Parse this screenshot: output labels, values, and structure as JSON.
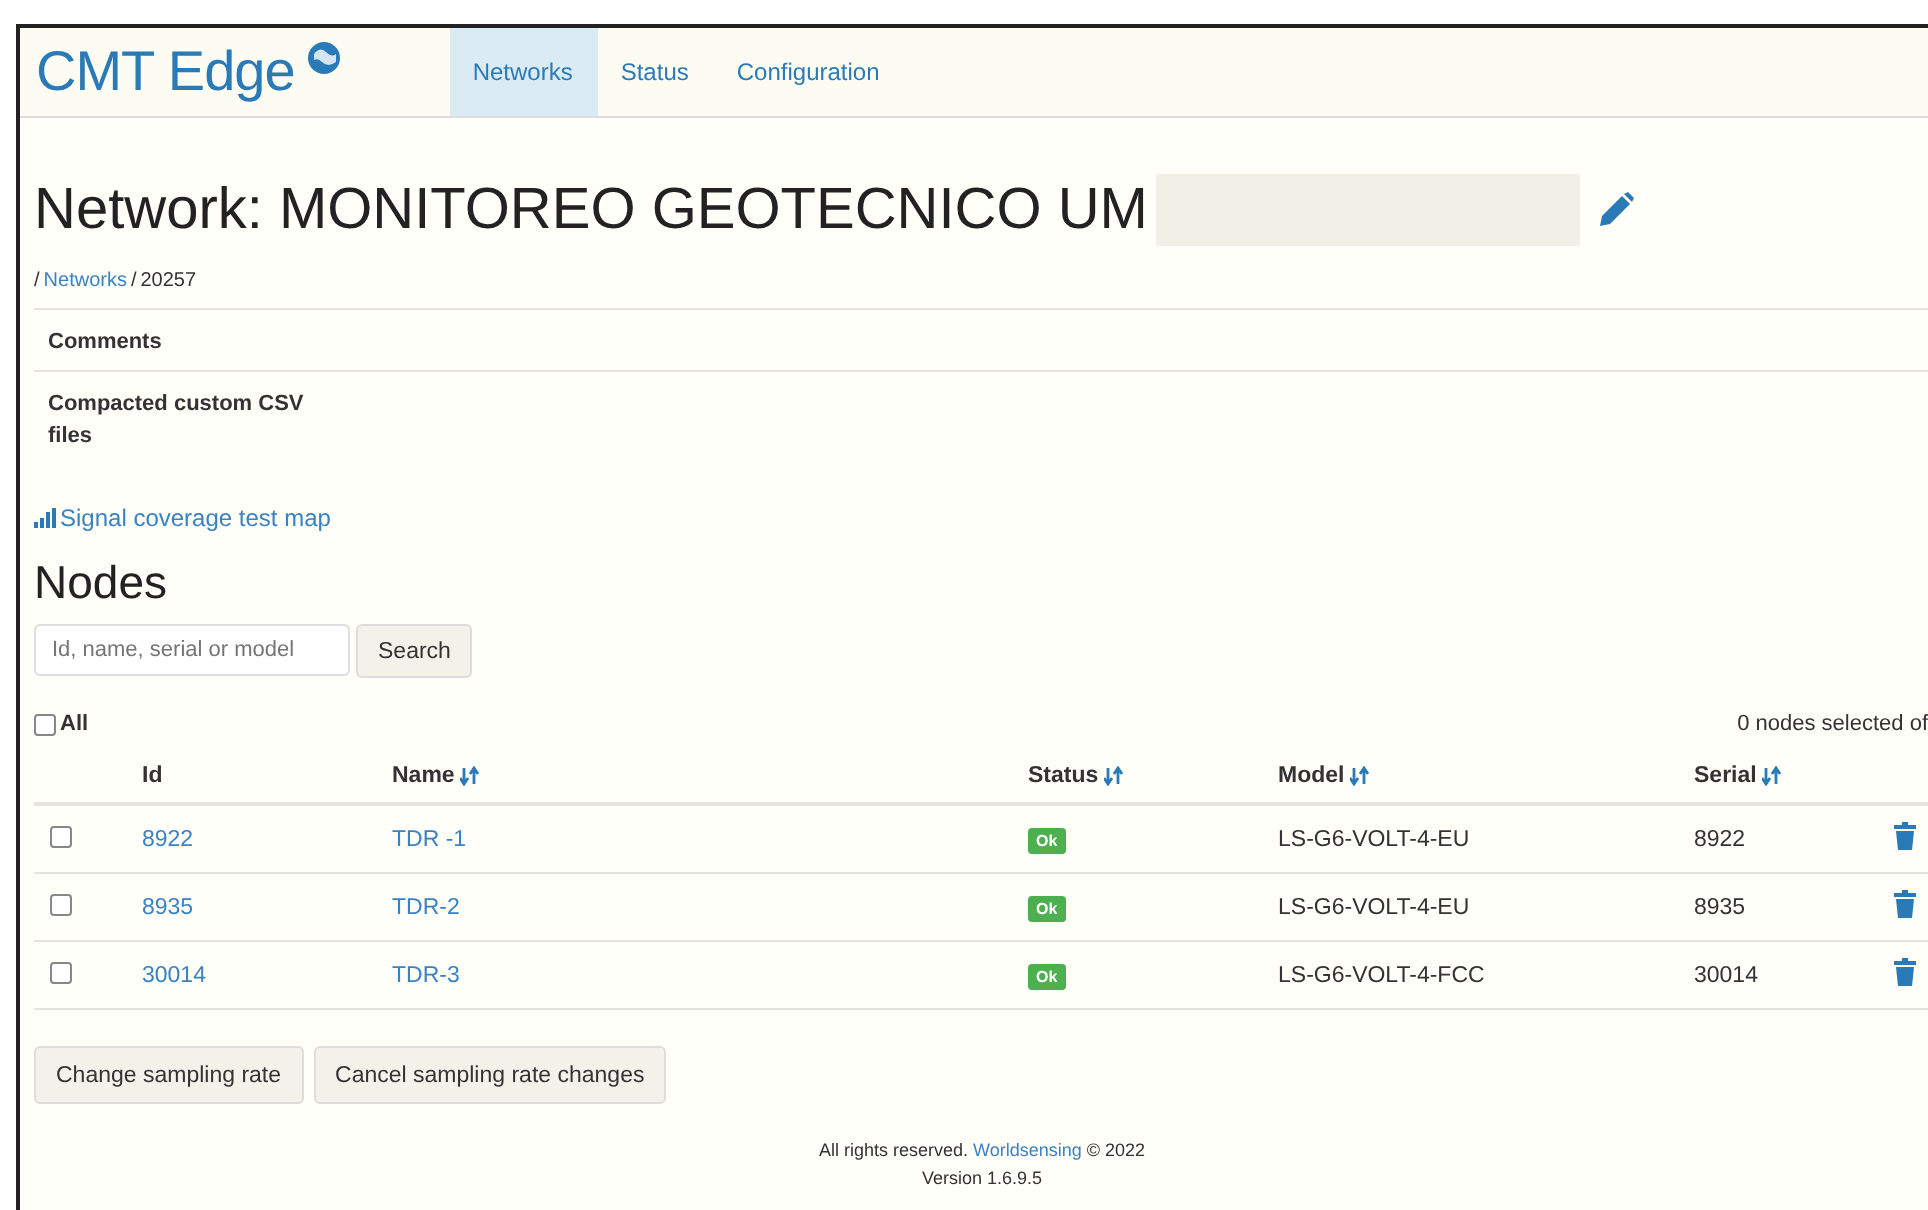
{
  "header": {
    "logo": "CMT Edge",
    "nav": [
      {
        "label": "Networks",
        "selected": true
      },
      {
        "label": "Status",
        "selected": false
      },
      {
        "label": "Configuration",
        "selected": false
      }
    ]
  },
  "title": "Network: MONITOREO GEOTECNICO UM",
  "breadcrumb": {
    "separator": "/",
    "link": "Networks",
    "current": "20257"
  },
  "details": [
    {
      "label": "Comments"
    },
    {
      "label": "Compacted custom CSV files"
    }
  ],
  "signal_link": "Signal coverage test map",
  "nodes": {
    "heading": "Nodes",
    "search": {
      "placeholder": "Id, name, serial or model",
      "button": "Search"
    },
    "select_all": {
      "label": "All",
      "checked": false
    },
    "selection_summary": "0 nodes selected of",
    "columns": [
      {
        "label": "Id",
        "sortable": false
      },
      {
        "label": "Name",
        "sortable": true
      },
      {
        "label": "Status",
        "sortable": true
      },
      {
        "label": "Model",
        "sortable": true
      },
      {
        "label": "Serial",
        "sortable": true
      }
    ],
    "rows": [
      {
        "checked": false,
        "id": "8922",
        "name": "TDR -1",
        "status": "Ok",
        "model": "LS-G6-VOLT-4-EU",
        "serial": "8922"
      },
      {
        "checked": false,
        "id": "8935",
        "name": "TDR-2",
        "status": "Ok",
        "model": "LS-G6-VOLT-4-EU",
        "serial": "8935"
      },
      {
        "checked": false,
        "id": "30014",
        "name": "TDR-3",
        "status": "Ok",
        "model": "LS-G6-VOLT-4-FCC",
        "serial": "30014"
      }
    ],
    "buttons": [
      "Change sampling rate",
      "Cancel sampling rate changes"
    ]
  },
  "footer": {
    "text": "All rights reserved.",
    "link": "Worldsensing",
    "copyright": "© 2022",
    "version": "Version 1.6.9.5"
  }
}
